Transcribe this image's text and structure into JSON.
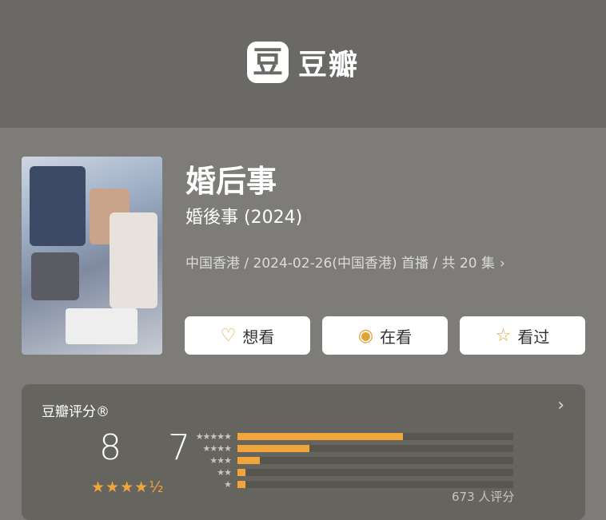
{
  "header": {
    "logo_glyph": "豆",
    "logo_text": "豆瓣"
  },
  "item": {
    "title": "婚后事",
    "original_title": "婚後事 (2024)",
    "meta": "中国香港 / 2024-02-26(中国香港) 首播 / 共 20 集",
    "meta_chevron": "›"
  },
  "actions": {
    "want": {
      "icon": "heart-plus-icon",
      "glyph": "♡",
      "label": "想看"
    },
    "watching": {
      "icon": "target-icon",
      "glyph": "◉",
      "label": "在看"
    },
    "watched": {
      "icon": "star-outline-icon",
      "glyph": "☆",
      "label": "看过"
    }
  },
  "rating": {
    "heading": "豆瓣评分®",
    "arrow": "›",
    "score": "8.7",
    "score_display": "8 7",
    "stars": "★★★★½",
    "star_labels": [
      "★★★★★",
      "★★★★",
      "★★★",
      "★★",
      "★"
    ],
    "distribution": [
      0.6,
      0.26,
      0.08,
      0.03,
      0.03
    ],
    "count_text": "673 人评分"
  },
  "colors": {
    "accent": "#f0a63a",
    "header_bg": "#6a6965",
    "page_bg": "#7d7c78",
    "card_bg": "#65645f"
  }
}
